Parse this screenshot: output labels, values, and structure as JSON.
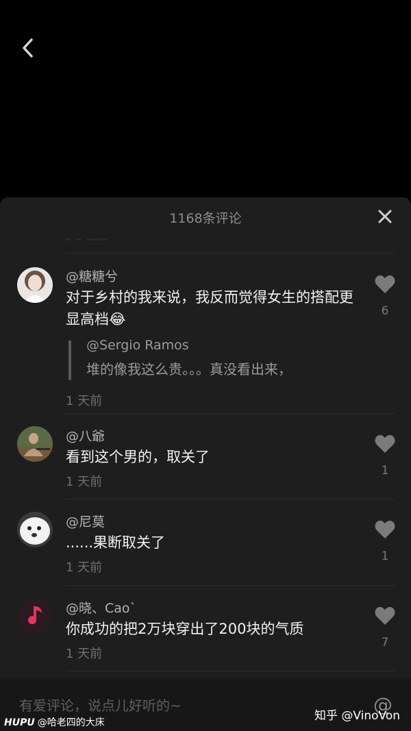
{
  "sheet": {
    "title": "1168条评论"
  },
  "comments": [
    {
      "username": "@糖糖兮",
      "text": "对于乡村的我来说，我反而觉得女生的搭配更显高档😂",
      "quote": {
        "username": "@Sergio Ramos",
        "text": "堆的像我这么贵。。。真没看出来，"
      },
      "time": "1 天前",
      "likes": "6"
    },
    {
      "username": "@八爺",
      "text": "看到这个男的，取关了",
      "time": "1 天前",
      "likes": "1"
    },
    {
      "username": "@尼莫",
      "text": "......果断取关了",
      "time": "1 天前",
      "likes": "1"
    },
    {
      "username": "@晓、Cao`",
      "text": "你成功的把2万块穿出了200块的气质",
      "time": "1 天前",
      "likes": "7"
    }
  ],
  "input": {
    "placeholder": "有爱评论，说点儿好听的~",
    "at_symbol": "@"
  },
  "watermark": {
    "brand": "HUPU",
    "handle": "@哈老四的大床",
    "zhihu": "知乎 @VinoVon"
  },
  "colors": {
    "accent_music": "#e8335a"
  }
}
